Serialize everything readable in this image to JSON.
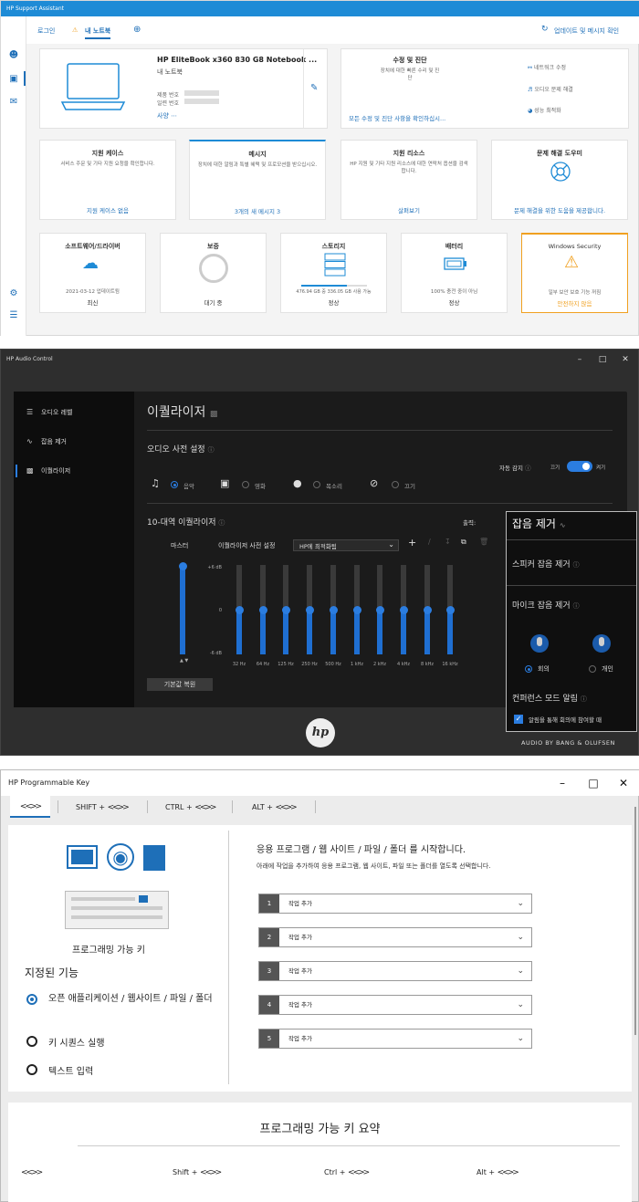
{
  "support": {
    "title": "HP Support Assistant",
    "nav": {
      "login": "로그인",
      "my_notebook": "내 노트북",
      "update": "업데이트 및 메시지 확인"
    },
    "device": {
      "name": "HP EliteBook x360 830 G8 Notebook ...",
      "sub": "내 노트북",
      "product_no": "제품 번호",
      "serial_no": "일련 번호",
      "specs": "사양"
    },
    "repair": {
      "title": "수정 및 진단",
      "desc": "장치에 대한 빠른 수리 및 진\n단",
      "link": "모든 수정 및 진단 사항을 확인하십시...",
      "items": [
        "네트워크 수정",
        "오디오 문제 해결",
        "성능 최적화"
      ]
    },
    "cards_row2": [
      {
        "title": "지원 케이스",
        "desc": "서비스 주문 및 기타 지원 요청을 확인합니다.",
        "link": "지원 케이스 없음"
      },
      {
        "title": "메시지",
        "desc": "장치에 대한 알림과 특별 혜택 및 프로모션을 받으십시오.",
        "link": "3개의 새 메시지 3"
      },
      {
        "title": "지원 리소스",
        "desc": "HP 지원 및 기타 지원 리소스에 대한 연락처 옵션을 검색합니다.",
        "link": "살펴보기"
      },
      {
        "title": "문제 해결 도우미",
        "desc": "",
        "link": "문제 해결을 위한 도움을 제공합니다."
      }
    ],
    "cards_row3": [
      {
        "title": "소프트웨어/드라이버",
        "info": "2021-03-12 업데이트됨",
        "status": "최신"
      },
      {
        "title": "보증",
        "info": "",
        "status": "대기 중"
      },
      {
        "title": "스토리지",
        "info": "476.94 GB 중 336.05 GB 사용 가능",
        "status": "정상"
      },
      {
        "title": "배터리",
        "info": "100% 충전 중이 아님",
        "status": "정상"
      },
      {
        "title": "Windows Security",
        "info": "일부 보안 보호 기능 꺼짐",
        "status": "안전하지 않음"
      }
    ],
    "storage_fill": 0.7,
    "accent": "#1e6fb8",
    "warning": "#f0a020"
  },
  "audio": {
    "title": "HP Audio Control",
    "nav": [
      "오디오 레벨",
      "잡음 제거",
      "이퀄라이저"
    ],
    "heading": "이퀄라이저",
    "preset_section": "오디오 사전 설정",
    "auto_detect": "자동 감지",
    "toggle_off": "끄기",
    "toggle_on": "켜기",
    "presets": [
      "음악",
      "영화",
      "목소리",
      "끄기"
    ],
    "eq_section": "10-대역 이퀄라이저",
    "output_label": "출력:",
    "master": "마스터",
    "preset_label": "이퀄라이저 사전 설정",
    "preset_value": "HP에 최적화됨",
    "db_labels": [
      "+6 dB",
      "0",
      "-6 dB"
    ],
    "freqs": [
      "32 Hz",
      "64 Hz",
      "125 Hz",
      "250 Hz",
      "500 Hz",
      "1 kHz",
      "2 kHz",
      "4 kHz",
      "8 kHz",
      "16 kHz"
    ],
    "band_values_db": [
      0,
      0,
      0,
      0,
      0,
      0,
      0,
      0,
      0,
      0
    ],
    "master_level": 1.0,
    "reset": "기본값 복원",
    "brand": "AUDIO BY BANG & OLUFSEN",
    "popup": {
      "title": "잡음 제거",
      "speaker": "스피커 잡음 제거",
      "mic": "마이크 잡음 제거",
      "mode_meeting": "회의",
      "mode_personal": "개인",
      "conference": "컨퍼런스 모드 알림",
      "conference_check": "알림을 통해 회의에 참여할 때"
    }
  },
  "progkey": {
    "title": "HP Programmable Key",
    "tabs": [
      "SHIFT +",
      "CTRL +",
      "ALT +"
    ],
    "key_label": "프로그래밍 가능 키",
    "assigned": "지정된 기능",
    "options": [
      "오픈 애플리케이션 / 웹사이트 / 파일 / 폴더",
      "키 시퀀스 실행",
      "텍스트 입력"
    ],
    "heading": "응용 프로그램 / 웹 사이트 / 파일 / 폴더 를 시작합니다.",
    "desc": "아래에 작업을 추가하여 응용 프로그램, 웹 사이트, 파일 또는 폴더를 열도록 선택합니다.",
    "actions": [
      {
        "num": "1",
        "label": "작업 추가"
      },
      {
        "num": "2",
        "label": "작업 추가"
      },
      {
        "num": "3",
        "label": "작업 추가"
      },
      {
        "num": "4",
        "label": "작업 추가"
      },
      {
        "num": "5",
        "label": "작업 추가"
      }
    ],
    "summary_title": "프로그래밍 가능 키 요약",
    "summary_keys": [
      "Shift +",
      "Ctrl +",
      "Alt +"
    ]
  }
}
